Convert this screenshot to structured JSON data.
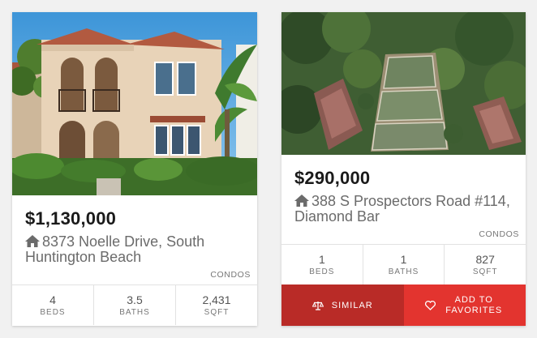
{
  "listings": [
    {
      "price": "$1,130,000",
      "address": "8373 Noelle Drive, South Huntington Beach",
      "type": "CONDOS",
      "stats": [
        {
          "value": "4",
          "label": "BEDS"
        },
        {
          "value": "3.5",
          "label": "BATHS"
        },
        {
          "value": "2,431",
          "label": "SQFT"
        }
      ]
    },
    {
      "price": "$290,000",
      "address": "388 S Prospectors Road #114, Diamond Bar",
      "type": "CONDOS",
      "stats": [
        {
          "value": "1",
          "label": "BEDS"
        },
        {
          "value": "1",
          "label": "BATHS"
        },
        {
          "value": "827",
          "label": "SQFT"
        }
      ],
      "actions": {
        "similar_label": "SIMILAR",
        "favorites_label": "ADD TO FAVORITES"
      }
    }
  ],
  "colors": {
    "similar_button": "#b92b27",
    "favorites_button": "#e3342f"
  },
  "icons": {
    "address": "home-icon",
    "similar": "balance-scale-icon",
    "favorites": "heart-icon"
  }
}
